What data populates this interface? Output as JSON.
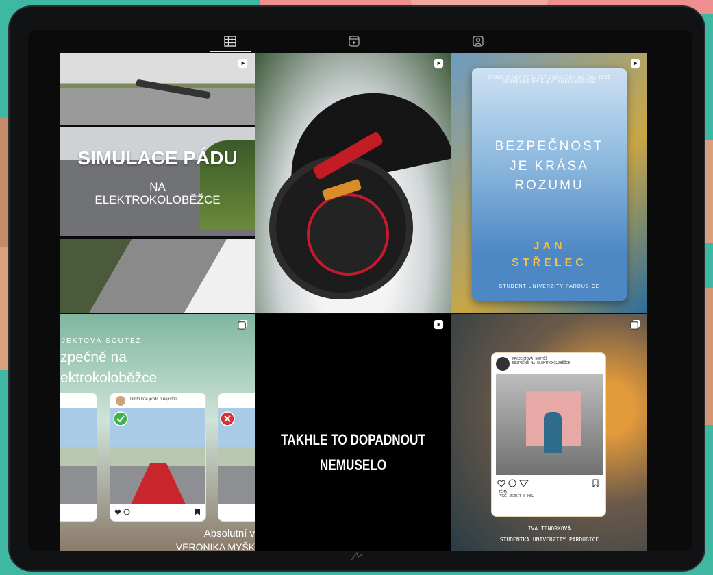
{
  "tabs": [
    {
      "icon": "grid-icon",
      "active": true
    },
    {
      "icon": "reels-icon",
      "active": false
    },
    {
      "icon": "tagged-icon",
      "active": false
    }
  ],
  "posts": {
    "sim": {
      "badge": "reel-icon",
      "title": "SIMULACE PÁDU",
      "sub1": "NA",
      "sub2": "ELEKTROKOLOBĚŽCE"
    },
    "scooter": {
      "badge": "reel-icon"
    },
    "poster": {
      "badge": "reel-icon",
      "top": "STUDENTSKÝ PROJEKT ZAPOJENÝ DO SOUTĚŽE BEZPEČNĚ NA ELEKTROKOLOBĚŽCE",
      "title1": "BEZPEČNOST",
      "title2": "JE KRÁSA",
      "title3": "ROZUMU",
      "name1": "JAN",
      "name2": "STŘELEC",
      "foot": "STUDENT UNIVERZITY PARDUBICE"
    },
    "carousel": {
      "badge": "carousel-icon",
      "small": "JEKTOVÁ SOUTĚŽ",
      "line1": "zpečně na",
      "line2": "ektrokoloběžce",
      "card_question": "Tímto kde jezdit o nejisto?",
      "bottom1": "Absolutní v",
      "bottom2": "VERONIKA MYŠK"
    },
    "text": {
      "badge": "reel-icon",
      "line1": "TAKHLE TO DOPADNOUT",
      "line2": "NEMUSELO"
    },
    "post": {
      "badge": "carousel-icon",
      "head1": "PROJEKTOVÁ SOUTĚŽ",
      "head2": "BEZPEČNĚ NA ELEKTROKOLOBĚŽCE",
      "caption1": "TÉMA:",
      "caption2": "PROČ JEZDIT S HEL",
      "foot1": "IVA TENORKOVÁ",
      "foot2": "STUDENTKA UNIVERZITY PARDUBICE"
    }
  },
  "colors": {
    "background": "#3fb8a3",
    "tablet": "#111214",
    "accent_red": "#c7192f",
    "name_yellow": "#f3c047"
  }
}
